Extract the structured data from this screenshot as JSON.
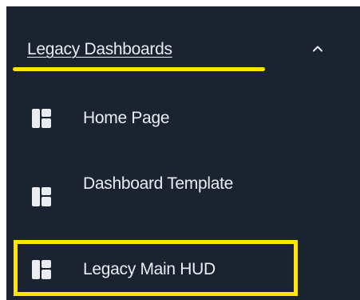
{
  "section": {
    "title": "Legacy Dashboards",
    "chevron_icon": "chevron-up-icon",
    "expanded": true
  },
  "nav": {
    "items": [
      {
        "label": "Home Page",
        "icon": "dashboard-icon"
      },
      {
        "label": "Dashboard Template",
        "icon": "dashboard-icon"
      },
      {
        "label": "Legacy Main HUD",
        "icon": "dashboard-icon"
      }
    ]
  },
  "colors": {
    "sidebar_bg": "#1b2330",
    "text": "#e9edf2",
    "highlight": "#ffe600"
  }
}
